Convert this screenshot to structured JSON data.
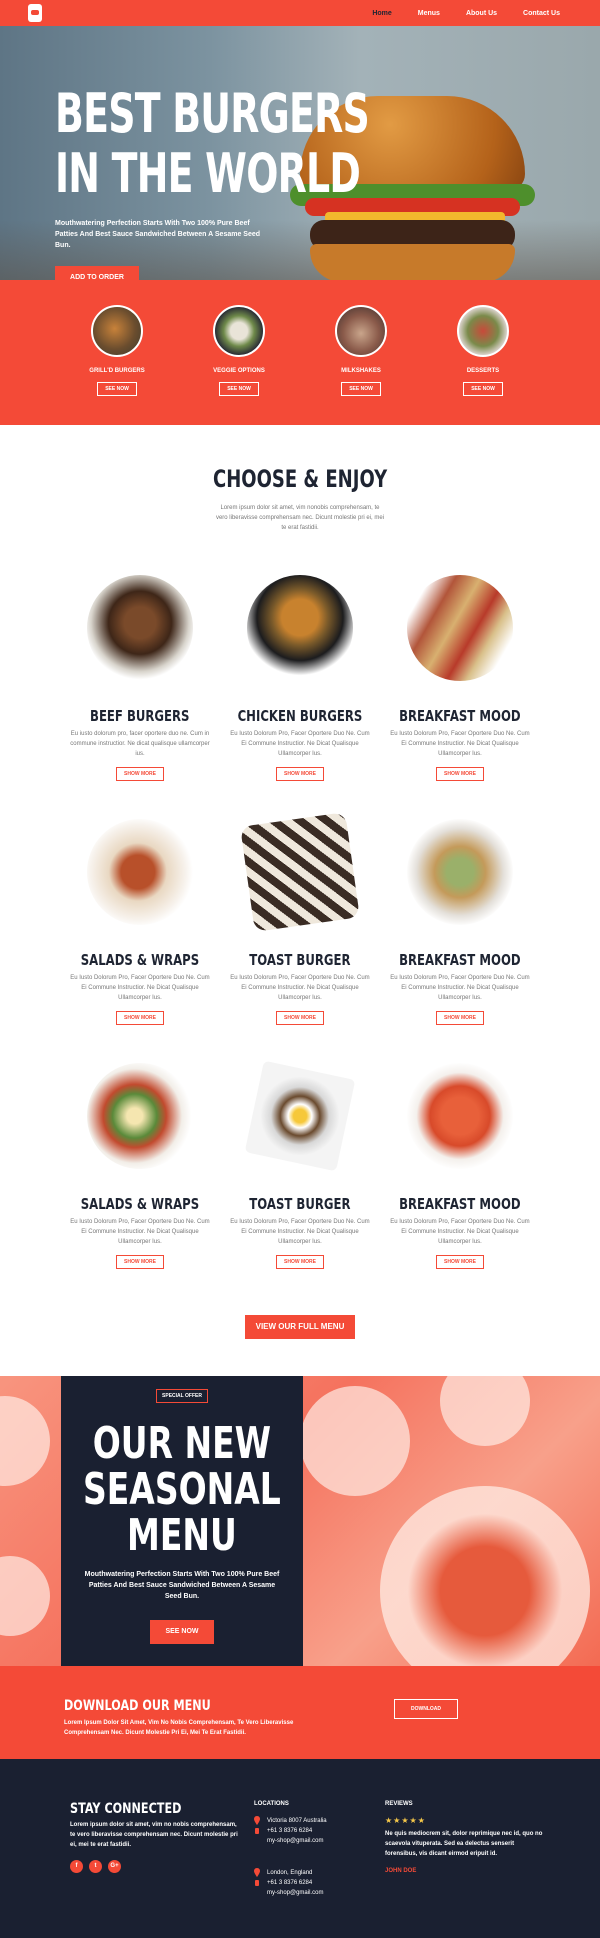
{
  "nav": {
    "items": [
      "Home",
      "Menus",
      "About Us",
      "Contact Us"
    ],
    "active_index": 0
  },
  "hero": {
    "title_line1": "BEST BURGERS",
    "title_line2": "IN THE WORLD",
    "subtitle": "Mouthwatering Perfection Starts With Two 100% Pure Beef Patties And Best Sauce Sandwiched Between A Sesame Seed Bun.",
    "cta": "ADD TO ORDER"
  },
  "categories": [
    {
      "name": "GRILL'D BURGERS",
      "button": "SEE NOW"
    },
    {
      "name": "VEGGIE OPTIONS",
      "button": "SEE NOW"
    },
    {
      "name": "MILKSHAKES",
      "button": "SEE NOW"
    },
    {
      "name": "DESSERTS",
      "button": "SEE NOW"
    }
  ],
  "choose": {
    "title": "CHOOSE & ENJOY",
    "text": "Lorem ipsum dolor sit amet, vim nonobis comprehensam, te vero liberavisse comprehensam nec. Dicunt molestie pri ei, mei te erat fastidii."
  },
  "menu_items": [
    {
      "name": "BEEF BURGERS",
      "desc": "Eu iusto dolorum pro, facer oportere duo ne. Cum in commune instructior. Ne dicat qualisque ullamcorper ius.",
      "button": "SHOW MORE"
    },
    {
      "name": "CHICKEN BURGERS",
      "desc": "Eu Iusto Dolorum Pro, Facer Oportere Duo Ne. Cum Ei Commune Instructior. Ne Dicat Qualisque Ullamcorper Ius.",
      "button": "SHOW MORE"
    },
    {
      "name": "BREAKFAST MOOD",
      "desc": "Eu Iusto Dolorum Pro, Facer Oportere Duo Ne. Cum Ei Commune Instructior. Ne Dicat Qualisque Ullamcorper Ius.",
      "button": "SHOW MORE"
    },
    {
      "name": "SALADS & WRAPS",
      "desc": "Eu Iusto Dolorum Pro, Facer Oportere Duo Ne. Cum Ei Commune Instructior. Ne Dicat Qualisque Ullamcorper Ius.",
      "button": "SHOW MORE"
    },
    {
      "name": "TOAST BURGER",
      "desc": "Eu Iusto Dolorum Pro, Facer Oportere Duo Ne. Cum Ei Commune Instructior. Ne Dicat Qualisque Ullamcorper Ius.",
      "button": "SHOW MORE"
    },
    {
      "name": "BREAKFAST MOOD",
      "desc": "Eu Iusto Dolorum Pro, Facer Oportere Duo Ne. Cum Ei Commune Instructior. Ne Dicat Qualisque Ullamcorper Ius.",
      "button": "SHOW MORE"
    },
    {
      "name": "SALADS & WRAPS",
      "desc": "Eu Iusto Dolorum Pro, Facer Oportere Duo Ne. Cum Ei Commune Instructior. Ne Dicat Qualisque Ullamcorper Ius.",
      "button": "SHOW MORE"
    },
    {
      "name": "TOAST BURGER",
      "desc": "Eu Iusto Dolorum Pro, Facer Oportere Duo Ne. Cum Ei Commune Instructior. Ne Dicat Qualisque Ullamcorper Ius.",
      "button": "SHOW MORE"
    },
    {
      "name": "BREAKFAST MOOD",
      "desc": "Eu Iusto Dolorum Pro, Facer Oportere Duo Ne. Cum Ei Commune Instructior. Ne Dicat Qualisque Ullamcorper Ius.",
      "button": "SHOW MORE"
    }
  ],
  "full_menu_button": "VIEW OUR FULL MENU",
  "special": {
    "tag": "SPECIAL OFFER",
    "title_line1": "OUR NEW",
    "title_line2": "SEASONAL",
    "title_line3": "MENU",
    "subtitle": "Mouthwatering Perfection Starts With Two 100% Pure Beef Patties And Best Sauce Sandwiched Between A Sesame Seed Bun.",
    "button": "SEE NOW"
  },
  "download": {
    "title": "DOWNLOAD OUR MENU",
    "text": "Lorem Ipsum Dolor Sit Amet, Vim No Nobis Comprehensam, Te Vero Liberavisse Comprehensam Nec. Dicunt Molestie Pri Ei, Mei Te Erat Fastidii.",
    "button": "DOWNLOAD"
  },
  "footer": {
    "connect_title": "STAY CONNECTED",
    "connect_text": "Lorem ipsum dolor sit amet, vim no nobis comprehensam, te vero liberavisse comprehensam nec. Dicunt molestie pri ei, mei te erat fastidii.",
    "socials": [
      "f",
      "t",
      "G+"
    ],
    "locations_title": "LOCATIONS",
    "location1": [
      "Victoria 8007 Australia",
      "+61 3 8376 6284",
      "my-shop@gmail.com"
    ],
    "location2": [
      "London, England",
      "+61 3 8376 6284",
      "my-shop@gmail.com"
    ],
    "reviews_title": "REVIEWS",
    "stars": "★★★★★",
    "review": "Ne quis mediocrem sit, dolor reprimique nec id, quo no scaevola vituperata. Sed ea delectus senserit forensibus, vis dicant eirmod eripuit id.",
    "reviewer": "JOHN DOE"
  },
  "colors": {
    "accent": "#f44a37",
    "dark": "#1a2031"
  }
}
